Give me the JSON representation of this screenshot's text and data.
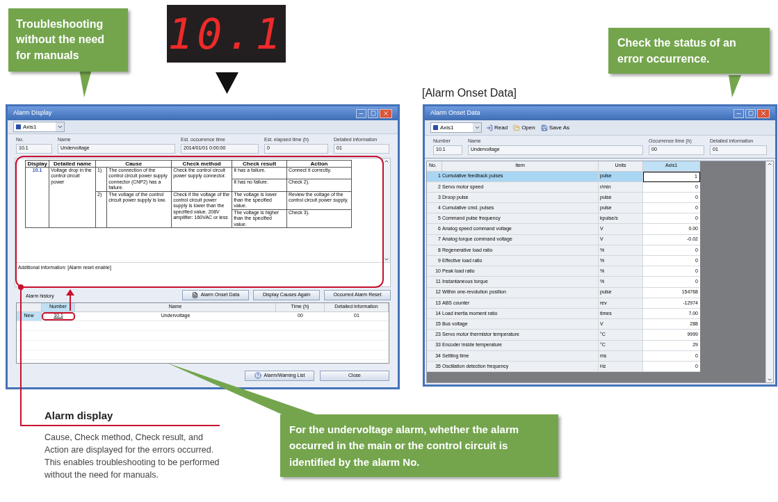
{
  "callout_manuals": "Troubleshooting without the need for manuals",
  "readout": "10.1",
  "callout_status": "Check the status of an error occurrence.",
  "onset_label": "[Alarm Onset Data]",
  "alarm_display": {
    "title": "Alarm Display",
    "axis": "Axis1",
    "fields": [
      {
        "label": "No.",
        "value": "10.1"
      },
      {
        "label": "Name",
        "value": "Undervoltage"
      },
      {
        "label": "Est. occurrence time",
        "value": "2014/01/01 0:00:00"
      },
      {
        "label": "Est. elapsed time (h)",
        "value": "0"
      },
      {
        "label": "Detailed information",
        "value": "01"
      }
    ],
    "detail_columns": [
      "Display",
      "Detailed name",
      "Cause",
      "Check method",
      "Check result",
      "Action"
    ],
    "detail": {
      "display": "10.1",
      "detailed_name": "Voltage drop in the control circuit power",
      "causes": [
        {
          "no": "1)",
          "text": "The connection of the control circuit power supply connector (CNP2) has a failure.",
          "check_method": "Check the control circuit power supply connector.",
          "results": [
            {
              "result": "It has a failure.",
              "action": "Connect it correctly."
            },
            {
              "result": "It has no failure.",
              "action": "Check 2)."
            }
          ]
        },
        {
          "no": "2)",
          "text": "The voltage of the control circuit power supply is low.",
          "check_method": "Check if the voltage of the control circuit power supply is lower than the specified value. 208V amplifier: 160VAC or less",
          "results": [
            {
              "result": "The voltage is lower than the specified value.",
              "action": "Review the voltage of the control circuit power supply."
            },
            {
              "result": "The voltage is higher than the specified value.",
              "action": "Check 3)."
            }
          ]
        }
      ]
    },
    "additional_info": "Additional information: [Alarm reset enable]",
    "history_label": "Alarm history",
    "action_buttons": [
      {
        "label": "Alarm Onset Data",
        "kind": "doc"
      },
      {
        "label": "Display Causes Again",
        "kind": "plain"
      },
      {
        "label": "Occurred Alarm Reset",
        "kind": "plain"
      }
    ],
    "history_columns": [
      "Number",
      "Name",
      "Time (h)",
      "Detailed information"
    ],
    "history_rows": [
      {
        "marker": "New",
        "number": "10.1",
        "name": "Undervoltage",
        "time": "00",
        "info": "01",
        "selected": true
      }
    ],
    "bottom_buttons": [
      {
        "label": "Alarm/Warning List",
        "kind": "help"
      },
      {
        "label": "Close",
        "kind": "plain"
      }
    ]
  },
  "alarm_onset": {
    "title": "Alarm Onset Data",
    "axis": "Axis1",
    "toolbar": [
      {
        "label": "Read",
        "kind": "read"
      },
      {
        "label": "Open",
        "kind": "open"
      },
      {
        "label": "Save As",
        "kind": "save"
      }
    ],
    "fields": [
      {
        "label": "Number",
        "value": "10.1"
      },
      {
        "label": "Name",
        "value": "Undervoltage"
      },
      {
        "label": "Occurrence time (h)",
        "value": "00"
      },
      {
        "label": "Detailed information",
        "value": "01"
      }
    ],
    "columns": [
      "No.",
      "Item",
      "Units",
      "Axis1"
    ],
    "rows": [
      {
        "no": "1",
        "item": "Cumulative feedback pulses",
        "unit": "pulse",
        "value": "1",
        "selected": true
      },
      {
        "no": "2",
        "item": "Servo motor speed",
        "unit": "r/min",
        "value": "0",
        "selected": false
      },
      {
        "no": "3",
        "item": "Droop pulse",
        "unit": "pulse",
        "value": "0",
        "selected": false
      },
      {
        "no": "4",
        "item": "Cumulative cmd. pulses",
        "unit": "pulse",
        "value": "0",
        "selected": false
      },
      {
        "no": "5",
        "item": "Command pulse frequency",
        "unit": "kpulse/s",
        "value": "0",
        "selected": false
      },
      {
        "no": "6",
        "item": "Analog speed command voltage",
        "unit": "V",
        "value": "0.00",
        "selected": false
      },
      {
        "no": "7",
        "item": "Analog torque command voltage",
        "unit": "V",
        "value": "-0.02",
        "selected": false
      },
      {
        "no": "8",
        "item": "Regenerative load ratio",
        "unit": "%",
        "value": "0",
        "selected": false
      },
      {
        "no": "9",
        "item": "Effective load ratio",
        "unit": "%",
        "value": "0",
        "selected": false
      },
      {
        "no": "10",
        "item": "Peak load ratio",
        "unit": "%",
        "value": "0",
        "selected": false
      },
      {
        "no": "11",
        "item": "Instantaneous torque",
        "unit": "%",
        "value": "0",
        "selected": false
      },
      {
        "no": "12",
        "item": "Within one-revolution position",
        "unit": "pulse",
        "value": "154768",
        "selected": false
      },
      {
        "no": "13",
        "item": "ABS counter",
        "unit": "rev",
        "value": "-12974",
        "selected": false
      },
      {
        "no": "14",
        "item": "Load inertia moment ratio",
        "unit": "times",
        "value": "7.00",
        "selected": false
      },
      {
        "no": "15",
        "item": "Bus voltage",
        "unit": "V",
        "value": "288",
        "selected": false
      },
      {
        "no": "23",
        "item": "Servo motor thermistor temperature",
        "unit": "°C",
        "value": "9999",
        "selected": false
      },
      {
        "no": "33",
        "item": "Encoder inside temperature",
        "unit": "°C",
        "value": "29",
        "selected": false
      },
      {
        "no": "34",
        "item": "Settling time",
        "unit": "ms",
        "value": "0",
        "selected": false
      },
      {
        "no": "35",
        "item": "Oscillation detection frequency",
        "unit": "Hz",
        "value": "0",
        "selected": false
      }
    ]
  },
  "note": {
    "title": "Alarm display",
    "text": "Cause, Check method, Check result, and Action are displayed for the errors occurred. This enables troubleshooting to be performed without the need for manuals."
  },
  "callout_undervoltage": "For the undervoltage alarm, whether the alarm occurred in the main or the control circuit is identified by the alarm No."
}
